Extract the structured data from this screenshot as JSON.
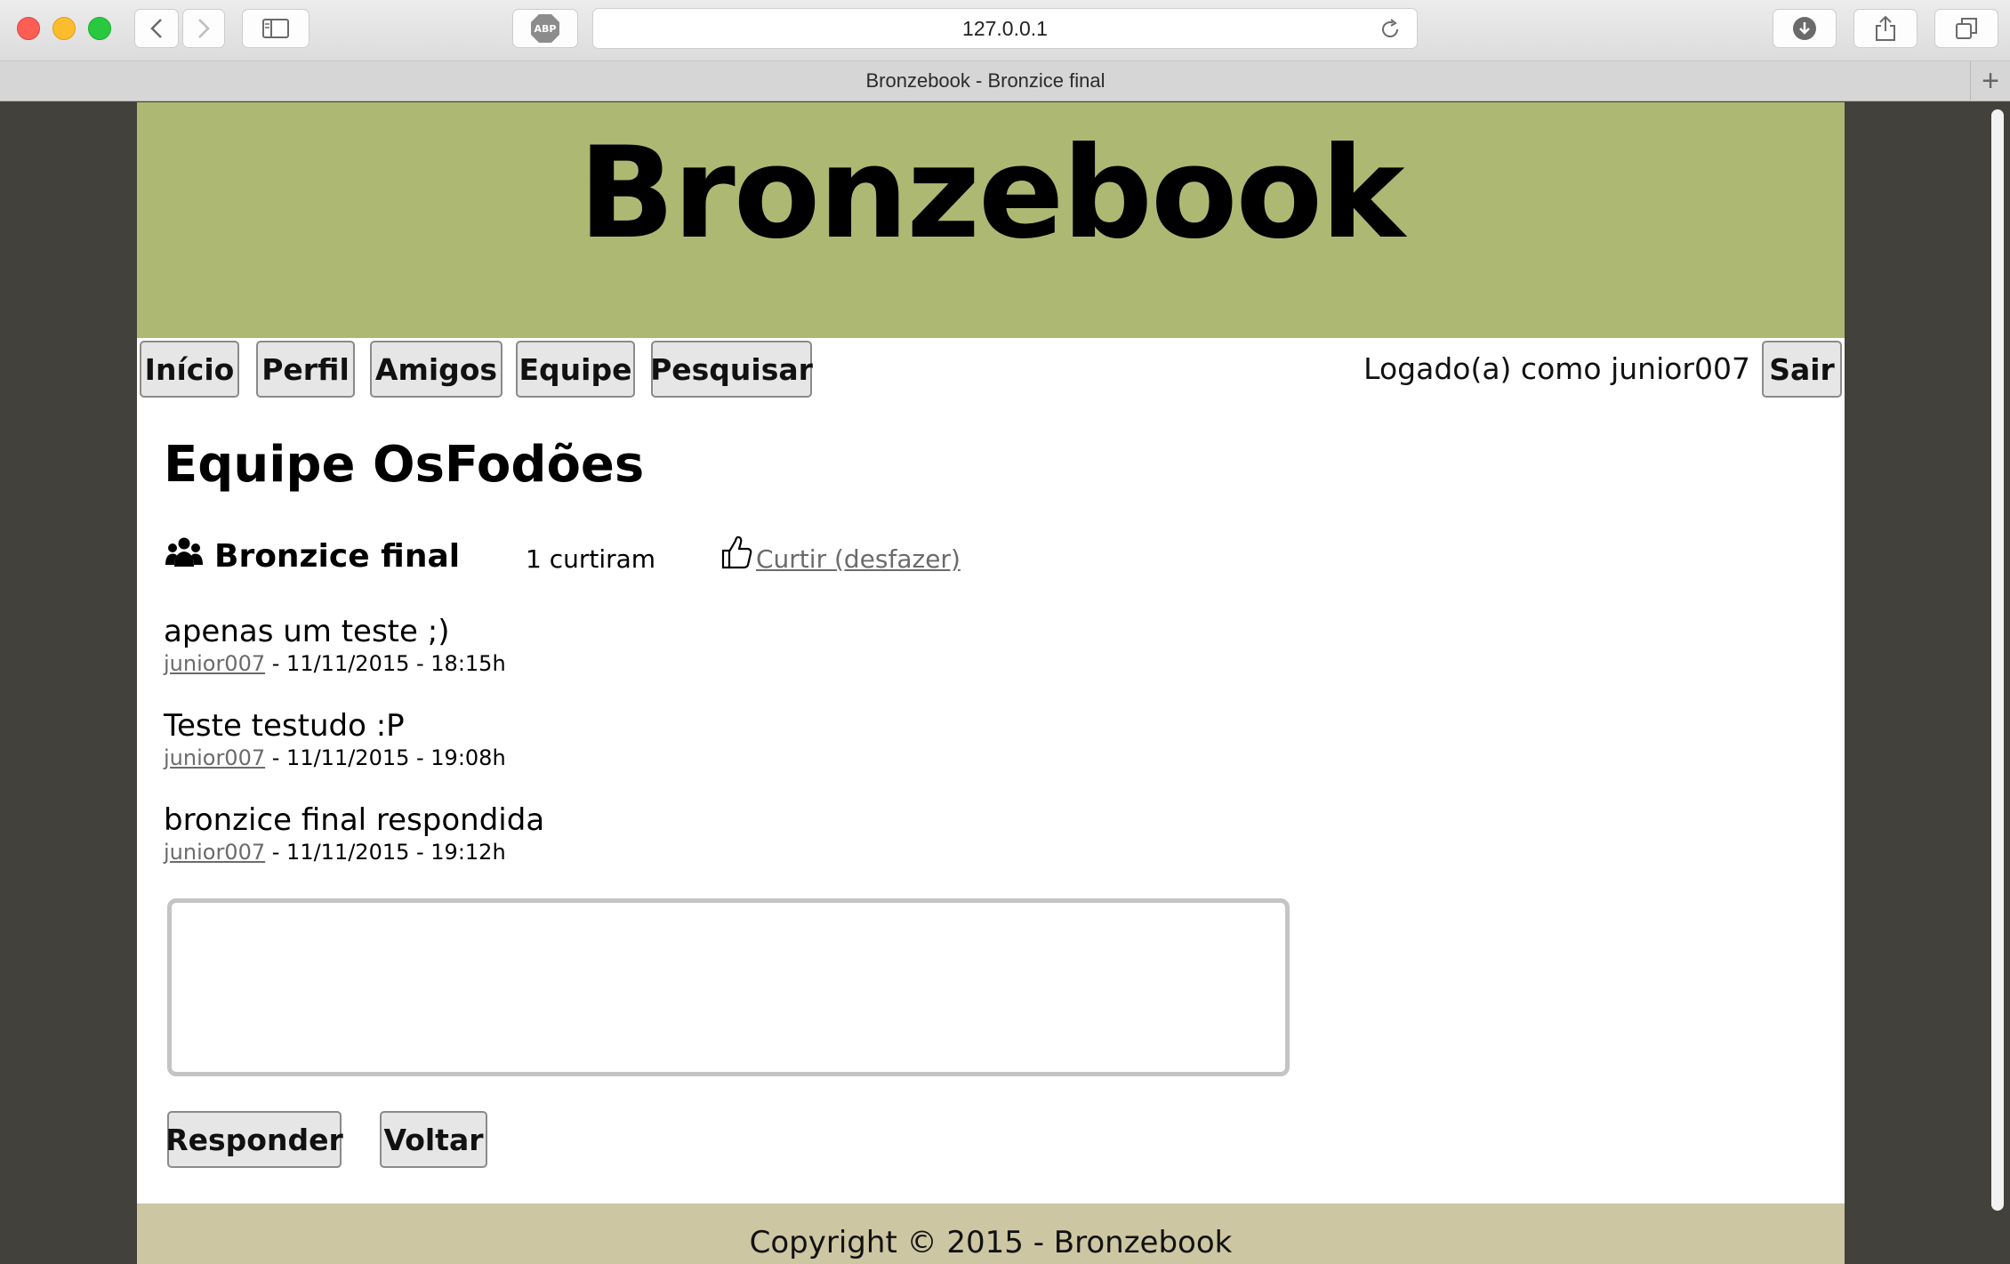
{
  "browser": {
    "url": "127.0.0.1",
    "tab_title": "Bronzebook - Bronzice final",
    "adblock_label": "ABP",
    "new_tab_glyph": "+"
  },
  "site": {
    "title": "Bronzebook",
    "header_color": "#adb973",
    "footer_color": "#cdc6a2"
  },
  "nav": {
    "items": [
      "Início",
      "Perfil",
      "Amigos",
      "Equipe",
      "Pesquisar"
    ],
    "logged_in_text": "Logado(a) como junior007",
    "logout_label": "Sair"
  },
  "main": {
    "heading": "Equipe OsFodões",
    "topic": {
      "icon": "group-icon",
      "title": "Bronzice final",
      "likes_text": "1 curtiram",
      "like_icon": "thumbs-up-icon",
      "like_link": " Curtir (desfazer)"
    },
    "posts": [
      {
        "message": "apenas um teste ;)",
        "author": "junior007",
        "date": " - 11/11/2015 - 18:15h"
      },
      {
        "message": "Teste testudo :P",
        "author": "junior007",
        "date": " - 11/11/2015 - 19:08h"
      },
      {
        "message": "bronzice final respondida",
        "author": "junior007",
        "date": " - 11/11/2015 - 19:12h"
      }
    ],
    "reply_value": "",
    "reply_button": "Responder",
    "back_button": "Voltar"
  },
  "footer": {
    "copyright": "Copyright © 2015 - Bronzebook"
  }
}
